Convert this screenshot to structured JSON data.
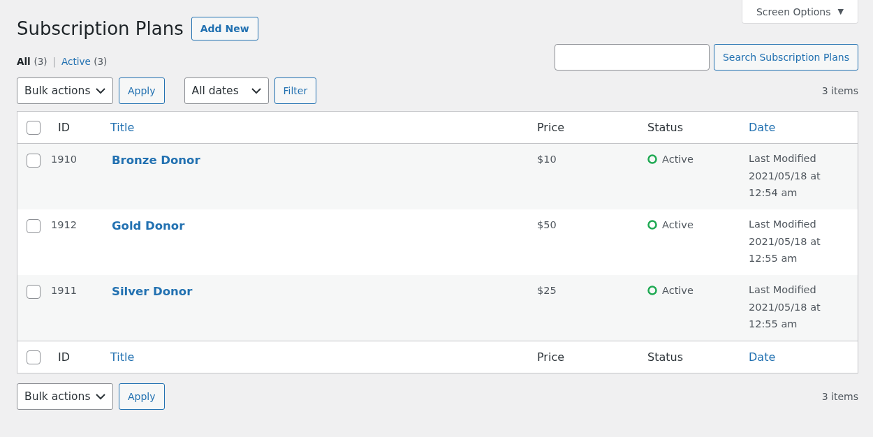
{
  "screen_options": {
    "label": "Screen Options",
    "caret": "▼"
  },
  "title": "Subscription Plans",
  "add_new": "Add New",
  "views": [
    {
      "label": "All",
      "count": "(3)",
      "selected": true
    },
    {
      "label": "Active",
      "count": "(3)",
      "selected": false
    }
  ],
  "view_separator": "|",
  "search": {
    "button": "Search Subscription Plans"
  },
  "top_nav": {
    "bulk_actions": "Bulk actions",
    "apply": "Apply",
    "dates": "All dates",
    "filter": "Filter",
    "items": "3 items"
  },
  "columns": {
    "select_all_checked": false,
    "id": "ID",
    "title": "Title",
    "price": "Price",
    "status": "Status",
    "date": "Date"
  },
  "rows": [
    {
      "checked": false,
      "id": "1910",
      "title": "Bronze Donor",
      "price": "$10",
      "status": "Active",
      "date_lines": [
        "Last Modified",
        "2021/05/18 at",
        "12:54 am"
      ]
    },
    {
      "checked": false,
      "id": "1912",
      "title": "Gold Donor",
      "price": "$50",
      "status": "Active",
      "date_lines": [
        "Last Modified",
        "2021/05/18 at",
        "12:55 am"
      ]
    },
    {
      "checked": false,
      "id": "1911",
      "title": "Silver Donor",
      "price": "$25",
      "status": "Active",
      "date_lines": [
        "Last Modified",
        "2021/05/18 at",
        "12:55 am"
      ]
    }
  ],
  "footer_columns": {
    "select_all_checked": false,
    "id": "ID",
    "title": "Title",
    "price": "Price",
    "status": "Status",
    "date": "Date"
  },
  "bottom_nav": {
    "bulk_actions": "Bulk actions",
    "apply": "Apply",
    "items": "3 items"
  }
}
